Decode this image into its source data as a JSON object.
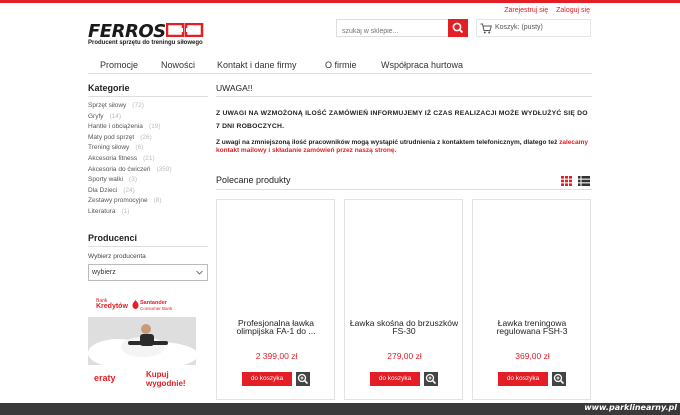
{
  "header": {
    "links": [
      "Zarejestruj się",
      "Zaloguj się"
    ],
    "logo_text": "FERROS",
    "logo_subtitle": "Producent sprzętu do treningu siłowego",
    "search_placeholder": "szukaj w sklepie...",
    "cart_label": "Koszyk: (pusty)"
  },
  "nav": [
    "Promocje",
    "Nowości",
    "Kontakt i dane firmy",
    "O firmie",
    "Współpraca hurtowa"
  ],
  "sidebar": {
    "categories_title": "Kategorie",
    "categories": [
      {
        "name": "Sprzęt siłowy",
        "count": "(72)"
      },
      {
        "name": "Gryfy",
        "count": "(14)"
      },
      {
        "name": "Hantle i obciążenia",
        "count": "(19)"
      },
      {
        "name": "Maty pod sprzęt",
        "count": "(26)"
      },
      {
        "name": "Trening siłowy",
        "count": "(6)"
      },
      {
        "name": "Akcesoria fitness",
        "count": "(21)"
      },
      {
        "name": "Akcesoria do ćwiczeń",
        "count": "(359)"
      },
      {
        "name": "Sporty walki",
        "count": "(3)"
      },
      {
        "name": "Dla Dzieci",
        "count": "(24)"
      },
      {
        "name": "Zestawy promocyjne",
        "count": "(8)"
      },
      {
        "name": "Literatura",
        "count": "(1)"
      }
    ],
    "producers_title": "Producenci",
    "producers_label": "Wybierz producenta",
    "producers_select": "wybierz",
    "banner": {
      "krd_small": "Bank",
      "krd_big": "Kredytów",
      "santander": "Santander",
      "santander_sub": "Consumer Bank",
      "eraty": "eraty",
      "kupuj": "Kupuj",
      "wygodnie": "wygodnie!"
    }
  },
  "main": {
    "uwaga_title": "UWAGA!!",
    "notice1": "Z UWAGI NA WZMOŻONĄ ILOŚĆ ZAMÓWIEŃ INFORMUJEMY IŻ CZAS REALIZACJI MOŻE WYDŁUŻYĆ SIĘ DO 7 DNI ROBOCZYCH.",
    "notice2_part1": "Z uwagi na zmniejszoną ilość pracowników mogą wystąpić utrudnienia z kontaktem telefonicznym, dlatego też ",
    "notice2_part2": "zalecamy kontakt mailowy i składanie zamówień przez naszą stronę.",
    "featured_title": "Polecane produkty",
    "products": [
      {
        "name": "Profesjonalna ławka olimpijska FA-1 do ...",
        "price": "2 399,00 zł",
        "button": "do koszyka"
      },
      {
        "name": "Ławka skośna do brzuszków FS-30",
        "price": "279,00 zł",
        "button": "do koszyka"
      },
      {
        "name": "Ławka treningowa regulowana FSH-3",
        "price": "369,00 zł",
        "button": "do koszyka"
      }
    ]
  },
  "watermark": "www.parklinearny.pl",
  "colors": {
    "accent": "#e31e24",
    "text": "#333333"
  }
}
